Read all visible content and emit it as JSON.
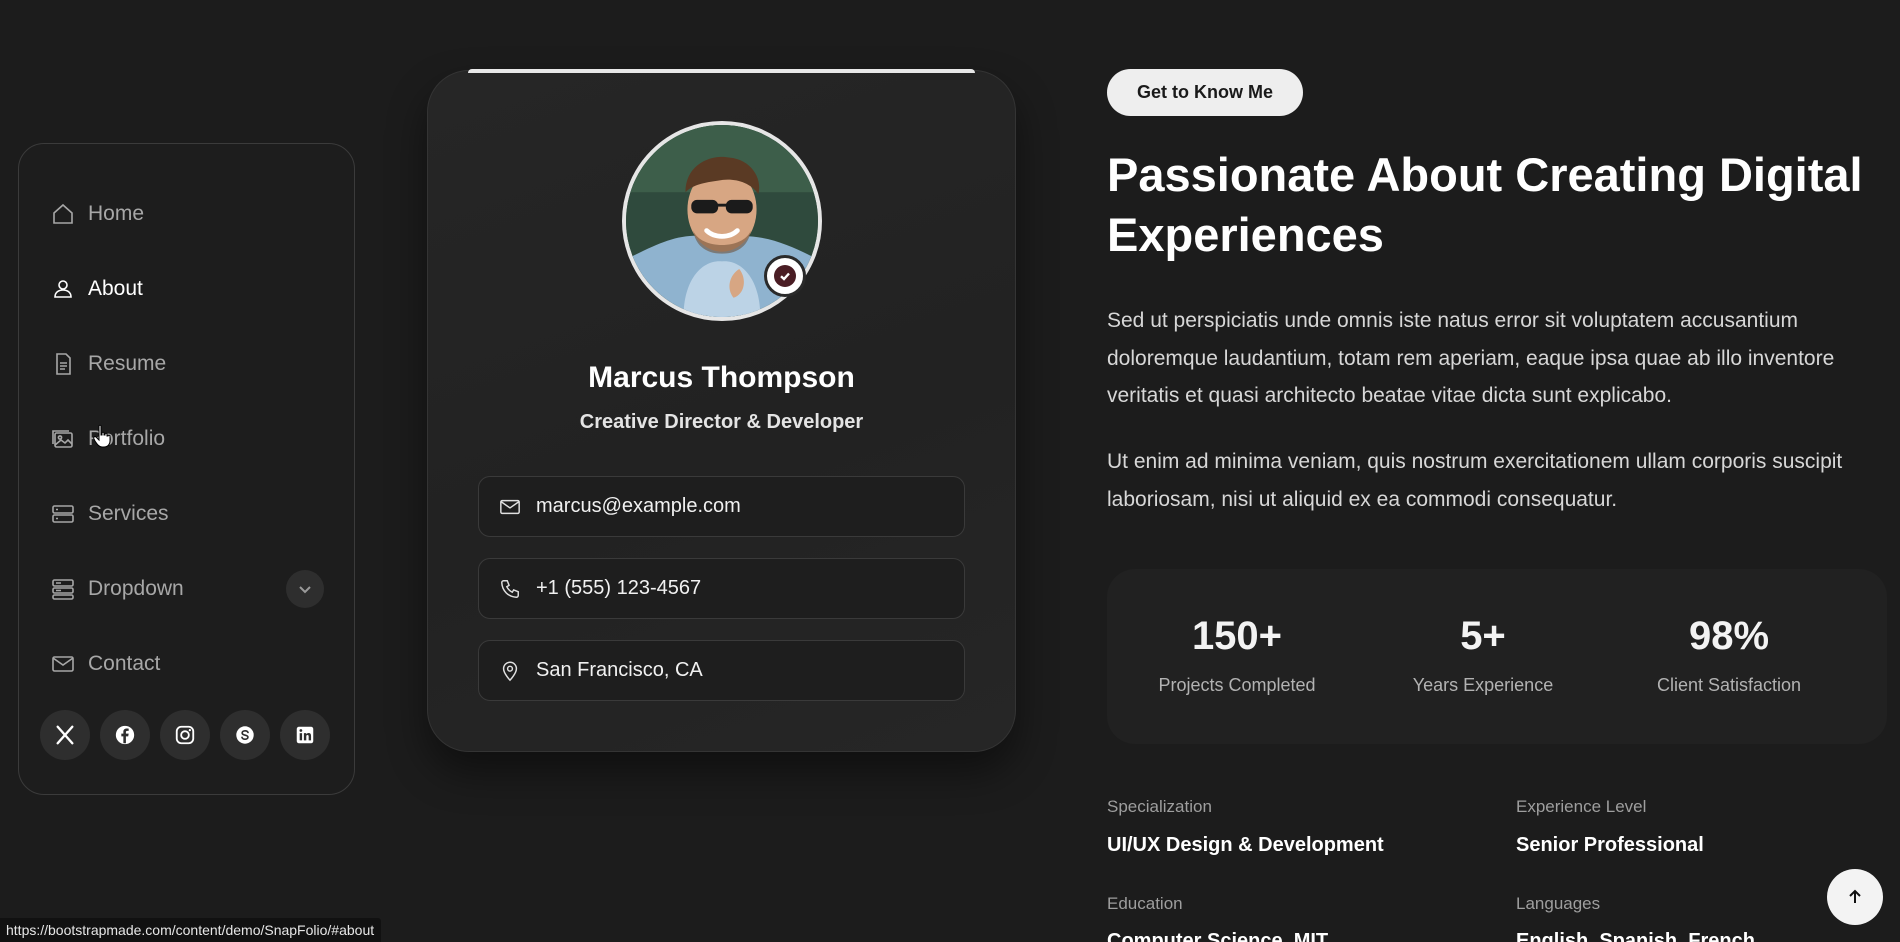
{
  "nav": {
    "items": [
      {
        "label": "Home",
        "icon": "house-icon"
      },
      {
        "label": "About",
        "icon": "person-icon"
      },
      {
        "label": "Resume",
        "icon": "file-text-icon"
      },
      {
        "label": "Portfolio",
        "icon": "images-icon"
      },
      {
        "label": "Services",
        "icon": "hdd-stack-icon"
      },
      {
        "label": "Dropdown",
        "icon": "menu-stack-icon"
      },
      {
        "label": "Contact",
        "icon": "envelope-icon"
      }
    ],
    "active": "About",
    "socials": [
      "x-twitter-icon",
      "facebook-icon",
      "instagram-icon",
      "skype-icon",
      "linkedin-icon"
    ]
  },
  "profile": {
    "name": "Marcus Thompson",
    "role": "Creative Director & Developer",
    "email": "marcus@example.com",
    "phone": "+1 (555) 123-4567",
    "location": "San Francisco, CA"
  },
  "about": {
    "badge": "Get to Know Me",
    "title": "Passionate About Creating Digital Experiences",
    "paragraph1": "Sed ut perspiciatis unde omnis iste natus error sit voluptatem accusantium doloremque laudantium, totam rem aperiam, eaque ipsa quae ab illo inventore veritatis et quasi architecto beatae vitae dicta sunt explicabo.",
    "paragraph2": "Ut enim ad minima veniam, quis nostrum exercitationem ullam corporis suscipit laboriosam, nisi ut aliquid ex ea commodi consequatur."
  },
  "stats": [
    {
      "value": "150+",
      "label": "Projects Completed"
    },
    {
      "value": "5+",
      "label": "Years Experience"
    },
    {
      "value": "98%",
      "label": "Client Satisfaction"
    }
  ],
  "info": {
    "specialization_label": "Specialization",
    "specialization_value": "UI/UX Design & Development",
    "experience_label": "Experience Level",
    "experience_value": "Senior Professional",
    "education_label": "Education",
    "education_value": "Computer Science, MIT",
    "languages_label": "Languages",
    "languages_value": "English, Spanish, French"
  },
  "status_url": "https://bootstrapmade.com/content/demo/SnapFolio/#about",
  "colors": {
    "background": "#1c1c1c",
    "badge_bg": "#eeeeee",
    "verified_accent": "#4a1d24"
  }
}
